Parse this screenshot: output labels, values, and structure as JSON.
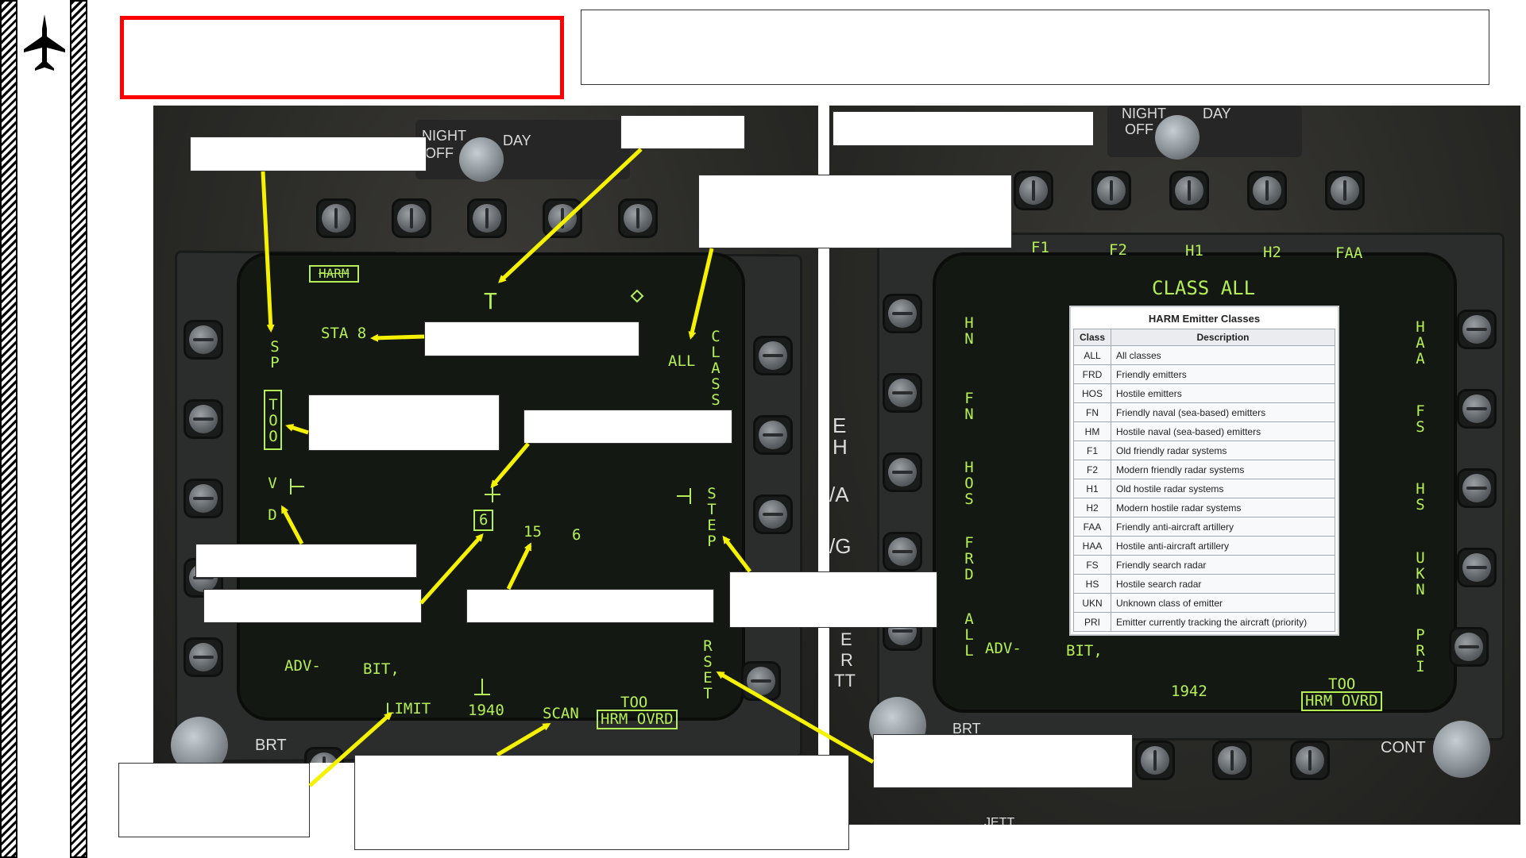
{
  "jet_icon": "fighter-jet-silhouette-icon",
  "left_mfd": {
    "knob": {
      "night": "NIGHT",
      "off": "OFF",
      "day": "DAY"
    },
    "top_labels": [
      "HARM",
      "T"
    ],
    "sta": "STA 8",
    "all": "ALL",
    "class_label": "CLASS",
    "sp": "SP",
    "too": "TOO",
    "ovrd_vert": "V D",
    "step": "STEP",
    "rset": "RSET",
    "cursor_num": "6",
    "num_15": "15",
    "num_6": "6",
    "adv": "ADV-",
    "bit": "BIT,",
    "limit": "LIMIT",
    "num_1940": "1940",
    "scan": "SCAN",
    "too_bottom": "TOO",
    "hrm_ovrd": "HRM OVRD",
    "brt": "BRT"
  },
  "right_mfd": {
    "knob": {
      "night": "NIGHT",
      "off": "OFF",
      "day": "DAY"
    },
    "top_labels": [
      "F1",
      "F2",
      "H1",
      "H2",
      "FAA"
    ],
    "title": "CLASS ALL",
    "left_labels": [
      "HN",
      "FN",
      "HOS",
      "FRD",
      "ALL"
    ],
    "right_labels": [
      "HAA",
      "FS",
      "HS",
      "UKN",
      "PRI"
    ],
    "adv": "ADV-",
    "bit": "BIT,",
    "num_1942": "1942",
    "too_bottom": "TOO",
    "hrm_ovrd": "HRM OVRD",
    "brt": "BRT",
    "cont": "CONT",
    "side_fragments": [
      "E",
      "H",
      "/A",
      "/G",
      "E",
      "R",
      "TT"
    ],
    "jett": "JETT"
  },
  "emitter_table": {
    "caption": "HARM Emitter Classes",
    "headers": [
      "Class",
      "Description"
    ],
    "rows": [
      [
        "ALL",
        "All classes"
      ],
      [
        "FRD",
        "Friendly emitters"
      ],
      [
        "HOS",
        "Hostile emitters"
      ],
      [
        "FN",
        "Friendly naval (sea-based) emitters"
      ],
      [
        "HM",
        "Hostile naval (sea-based) emitters"
      ],
      [
        "F1",
        "Old friendly radar systems"
      ],
      [
        "F2",
        "Modern friendly radar systems"
      ],
      [
        "H1",
        "Old hostile radar systems"
      ],
      [
        "H2",
        "Modern hostile radar systems"
      ],
      [
        "FAA",
        "Friendly anti-aircraft artillery"
      ],
      [
        "HAA",
        "Hostile anti-aircraft artillery"
      ],
      [
        "FS",
        "Friendly search radar"
      ],
      [
        "HS",
        "Hostile search radar"
      ],
      [
        "UKN",
        "Unknown class of emitter"
      ],
      [
        "PRI",
        "Emitter currently tracking the aircraft (priority)"
      ]
    ]
  },
  "colors": {
    "symbology_green": "#b6ef55",
    "arrow_yellow": "#f5f200",
    "highlight_red": "#ff0000"
  }
}
